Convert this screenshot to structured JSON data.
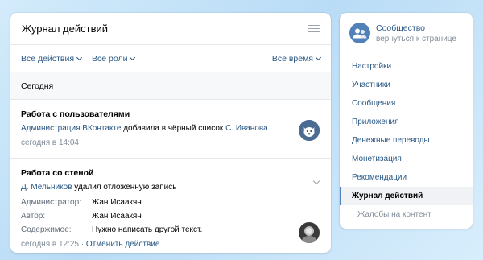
{
  "header": {
    "title": "Журнал действий",
    "filter_icon": "filter-list-icon"
  },
  "filters": {
    "actions": "Все действия",
    "roles": "Все роли",
    "period": "Всё время"
  },
  "day_label": "Сегодня",
  "entries": [
    {
      "title": "Работа с пользователями",
      "actor": "Администрация ВКонтакте",
      "action": "добавила в чёрный список",
      "target": "С. Иванова",
      "time": "сегодня в 14:04",
      "avatar_icon": "vk-admin-avatar"
    },
    {
      "title": "Работа со стеной",
      "actor": "Д. Мельников",
      "action": "удалил отложенную запись",
      "fields": [
        {
          "label": "Администратор:",
          "value": "Жан Исаакян"
        },
        {
          "label": "Автор:",
          "value": "Жан Исаакян"
        },
        {
          "label": "Содержимое:",
          "value": "Нужно написать другой текст."
        }
      ],
      "time": "сегодня в 12:25",
      "separator": "·",
      "undo": "Отменить действие",
      "avatar_icon": "user-avatar"
    }
  ],
  "sidebar": {
    "community_name": "Сообщество",
    "back_link": "вернуться к странице",
    "items": [
      {
        "label": "Настройки"
      },
      {
        "label": "Участники"
      },
      {
        "label": "Сообщения"
      },
      {
        "label": "Приложения"
      },
      {
        "label": "Денежные переводы"
      },
      {
        "label": "Монетизация"
      },
      {
        "label": "Рекомендации"
      },
      {
        "label": "Журнал действий"
      },
      {
        "label": "Жалобы на контент"
      }
    ]
  },
  "colors": {
    "accent": "#2a5885",
    "muted": "#818c99",
    "avatar_blue": "#5181b8"
  }
}
